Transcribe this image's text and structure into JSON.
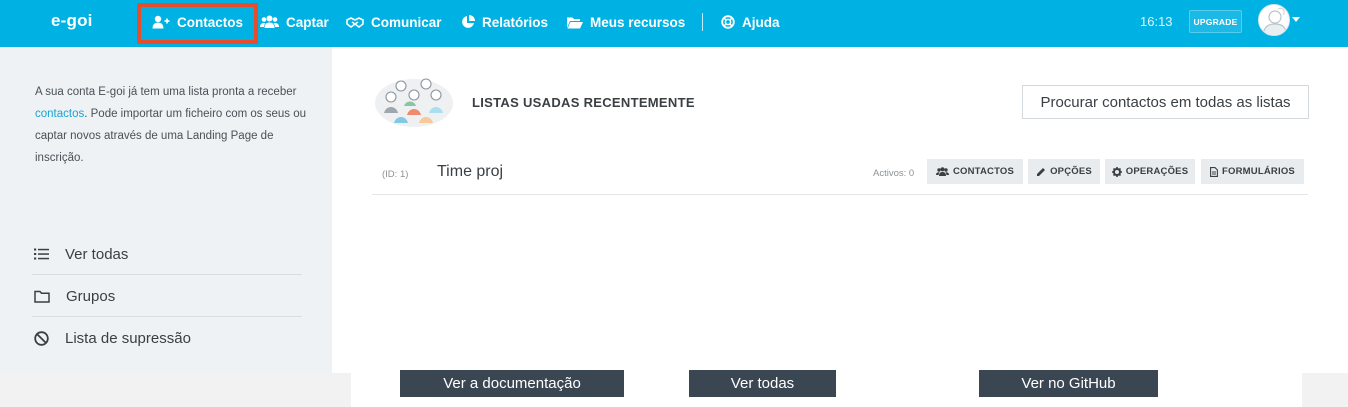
{
  "app": {
    "logo": "e-goi"
  },
  "nav": {
    "items": [
      {
        "label": "Contactos",
        "icon": "user-plus-icon"
      },
      {
        "label": "Captar",
        "icon": "users-icon"
      },
      {
        "label": "Comunicar",
        "icon": "handshake-icon"
      },
      {
        "label": "Relatórios",
        "icon": "pie-chart-icon"
      },
      {
        "label": "Meus recursos",
        "icon": "folder-open-icon"
      },
      {
        "label": "Ajuda",
        "icon": "help-circle-icon"
      }
    ],
    "time": "16:13",
    "upgrade_label": "UPGRADE",
    "highlight_color": "#e74c2b",
    "bar_color": "#00b2e3"
  },
  "sidebar": {
    "intro_before": "A sua conta E-goi já tem uma lista pronta a receber ",
    "intro_link": "contactos",
    "intro_after": ". Pode importar um ficheiro com os seus ou captar novos através de uma Landing Page de inscrição.",
    "items": [
      {
        "label": "Ver todas",
        "icon": "list-icon"
      },
      {
        "label": "Grupos",
        "icon": "folder-icon"
      },
      {
        "label": "Lista de supressão",
        "icon": "ban-icon"
      }
    ]
  },
  "main": {
    "section_title": "LISTAS USADAS RECENTEMENTE",
    "search_button": "Procurar contactos em todas as listas",
    "lists": [
      {
        "id": "(ID: 1)",
        "name": "Time proj",
        "active": "Activos: 0",
        "actions": [
          "CONTACTOS",
          "OPÇÕES",
          "OPERAÇÕES",
          "FORMULÁRIOS"
        ]
      }
    ]
  },
  "bottom_buttons": [
    "Ver a documentação",
    "Ver todas",
    "Ver no GitHub"
  ]
}
